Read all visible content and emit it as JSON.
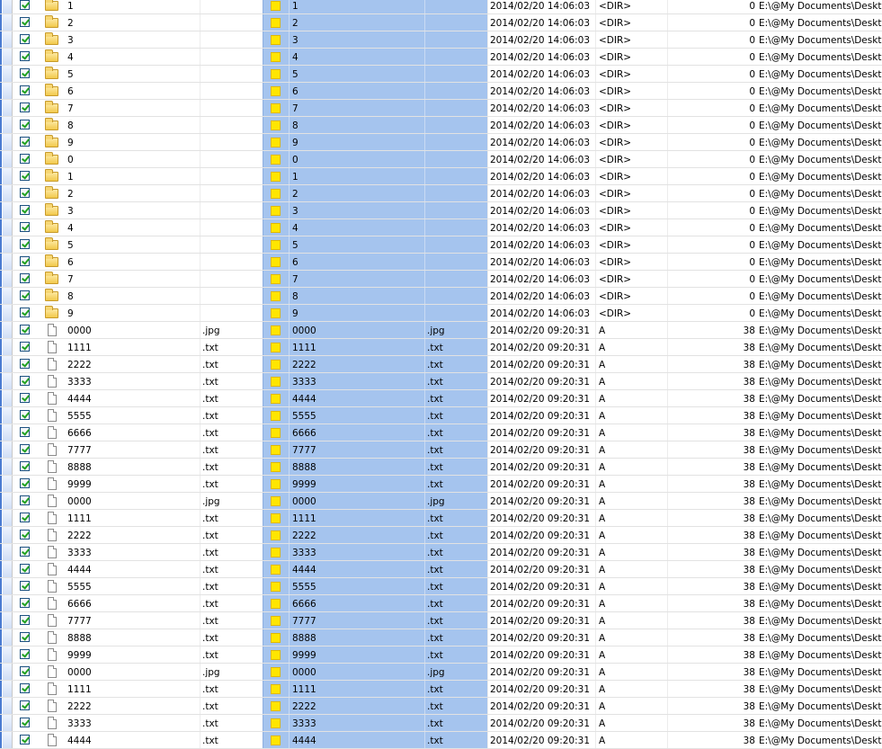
{
  "rows": [
    {
      "type": "folder",
      "checked": true,
      "name": "1",
      "ext": "",
      "sel_name": "1",
      "sel_ext": "",
      "date": "2014/02/20 14:06:03",
      "attr": "<DIR>",
      "size": "0",
      "path": "E:\\@My Documents\\Desktop"
    },
    {
      "type": "folder",
      "checked": true,
      "name": "2",
      "ext": "",
      "sel_name": "2",
      "sel_ext": "",
      "date": "2014/02/20 14:06:03",
      "attr": "<DIR>",
      "size": "0",
      "path": "E:\\@My Documents\\Desktop"
    },
    {
      "type": "folder",
      "checked": true,
      "name": "3",
      "ext": "",
      "sel_name": "3",
      "sel_ext": "",
      "date": "2014/02/20 14:06:03",
      "attr": "<DIR>",
      "size": "0",
      "path": "E:\\@My Documents\\Desktop"
    },
    {
      "type": "folder",
      "checked": true,
      "name": "4",
      "ext": "",
      "sel_name": "4",
      "sel_ext": "",
      "date": "2014/02/20 14:06:03",
      "attr": "<DIR>",
      "size": "0",
      "path": "E:\\@My Documents\\Desktop"
    },
    {
      "type": "folder",
      "checked": true,
      "name": "5",
      "ext": "",
      "sel_name": "5",
      "sel_ext": "",
      "date": "2014/02/20 14:06:03",
      "attr": "<DIR>",
      "size": "0",
      "path": "E:\\@My Documents\\Desktop"
    },
    {
      "type": "folder",
      "checked": true,
      "name": "6",
      "ext": "",
      "sel_name": "6",
      "sel_ext": "",
      "date": "2014/02/20 14:06:03",
      "attr": "<DIR>",
      "size": "0",
      "path": "E:\\@My Documents\\Desktop"
    },
    {
      "type": "folder",
      "checked": true,
      "name": "7",
      "ext": "",
      "sel_name": "7",
      "sel_ext": "",
      "date": "2014/02/20 14:06:03",
      "attr": "<DIR>",
      "size": "0",
      "path": "E:\\@My Documents\\Desktop"
    },
    {
      "type": "folder",
      "checked": true,
      "name": "8",
      "ext": "",
      "sel_name": "8",
      "sel_ext": "",
      "date": "2014/02/20 14:06:03",
      "attr": "<DIR>",
      "size": "0",
      "path": "E:\\@My Documents\\Desktop"
    },
    {
      "type": "folder",
      "checked": true,
      "name": "9",
      "ext": "",
      "sel_name": "9",
      "sel_ext": "",
      "date": "2014/02/20 14:06:03",
      "attr": "<DIR>",
      "size": "0",
      "path": "E:\\@My Documents\\Desktop"
    },
    {
      "type": "folder",
      "checked": true,
      "name": "0",
      "ext": "",
      "sel_name": "0",
      "sel_ext": "",
      "date": "2014/02/20 14:06:03",
      "attr": "<DIR>",
      "size": "0",
      "path": "E:\\@My Documents\\Desktop"
    },
    {
      "type": "folder",
      "checked": true,
      "name": "1",
      "ext": "",
      "sel_name": "1",
      "sel_ext": "",
      "date": "2014/02/20 14:06:03",
      "attr": "<DIR>",
      "size": "0",
      "path": "E:\\@My Documents\\Desktop"
    },
    {
      "type": "folder",
      "checked": true,
      "name": "2",
      "ext": "",
      "sel_name": "2",
      "sel_ext": "",
      "date": "2014/02/20 14:06:03",
      "attr": "<DIR>",
      "size": "0",
      "path": "E:\\@My Documents\\Desktop"
    },
    {
      "type": "folder",
      "checked": true,
      "name": "3",
      "ext": "",
      "sel_name": "3",
      "sel_ext": "",
      "date": "2014/02/20 14:06:03",
      "attr": "<DIR>",
      "size": "0",
      "path": "E:\\@My Documents\\Desktop"
    },
    {
      "type": "folder",
      "checked": true,
      "name": "4",
      "ext": "",
      "sel_name": "4",
      "sel_ext": "",
      "date": "2014/02/20 14:06:03",
      "attr": "<DIR>",
      "size": "0",
      "path": "E:\\@My Documents\\Desktop"
    },
    {
      "type": "folder",
      "checked": true,
      "name": "5",
      "ext": "",
      "sel_name": "5",
      "sel_ext": "",
      "date": "2014/02/20 14:06:03",
      "attr": "<DIR>",
      "size": "0",
      "path": "E:\\@My Documents\\Desktop"
    },
    {
      "type": "folder",
      "checked": true,
      "name": "6",
      "ext": "",
      "sel_name": "6",
      "sel_ext": "",
      "date": "2014/02/20 14:06:03",
      "attr": "<DIR>",
      "size": "0",
      "path": "E:\\@My Documents\\Desktop"
    },
    {
      "type": "folder",
      "checked": true,
      "name": "7",
      "ext": "",
      "sel_name": "7",
      "sel_ext": "",
      "date": "2014/02/20 14:06:03",
      "attr": "<DIR>",
      "size": "0",
      "path": "E:\\@My Documents\\Desktop"
    },
    {
      "type": "folder",
      "checked": true,
      "name": "8",
      "ext": "",
      "sel_name": "8",
      "sel_ext": "",
      "date": "2014/02/20 14:06:03",
      "attr": "<DIR>",
      "size": "0",
      "path": "E:\\@My Documents\\Desktop"
    },
    {
      "type": "folder",
      "checked": true,
      "name": "9",
      "ext": "",
      "sel_name": "9",
      "sel_ext": "",
      "date": "2014/02/20 14:06:03",
      "attr": "<DIR>",
      "size": "0",
      "path": "E:\\@My Documents\\Desktop"
    },
    {
      "type": "file",
      "checked": true,
      "name": "0000",
      "ext": ".jpg",
      "sel_name": "0000",
      "sel_ext": ".jpg",
      "date": "2014/02/20 09:20:31",
      "attr": "A",
      "size": "38",
      "path": "E:\\@My Documents\\Desktop"
    },
    {
      "type": "file",
      "checked": true,
      "name": "1111",
      "ext": ".txt",
      "sel_name": "1111",
      "sel_ext": ".txt",
      "date": "2014/02/20 09:20:31",
      "attr": "A",
      "size": "38",
      "path": "E:\\@My Documents\\Desktop"
    },
    {
      "type": "file",
      "checked": true,
      "name": "2222",
      "ext": ".txt",
      "sel_name": "2222",
      "sel_ext": ".txt",
      "date": "2014/02/20 09:20:31",
      "attr": "A",
      "size": "38",
      "path": "E:\\@My Documents\\Desktop"
    },
    {
      "type": "file",
      "checked": true,
      "name": "3333",
      "ext": ".txt",
      "sel_name": "3333",
      "sel_ext": ".txt",
      "date": "2014/02/20 09:20:31",
      "attr": "A",
      "size": "38",
      "path": "E:\\@My Documents\\Desktop"
    },
    {
      "type": "file",
      "checked": true,
      "name": "4444",
      "ext": ".txt",
      "sel_name": "4444",
      "sel_ext": ".txt",
      "date": "2014/02/20 09:20:31",
      "attr": "A",
      "size": "38",
      "path": "E:\\@My Documents\\Desktop"
    },
    {
      "type": "file",
      "checked": true,
      "name": "5555",
      "ext": ".txt",
      "sel_name": "5555",
      "sel_ext": ".txt",
      "date": "2014/02/20 09:20:31",
      "attr": "A",
      "size": "38",
      "path": "E:\\@My Documents\\Desktop"
    },
    {
      "type": "file",
      "checked": true,
      "name": "6666",
      "ext": ".txt",
      "sel_name": "6666",
      "sel_ext": ".txt",
      "date": "2014/02/20 09:20:31",
      "attr": "A",
      "size": "38",
      "path": "E:\\@My Documents\\Desktop"
    },
    {
      "type": "file",
      "checked": true,
      "name": "7777",
      "ext": ".txt",
      "sel_name": "7777",
      "sel_ext": ".txt",
      "date": "2014/02/20 09:20:31",
      "attr": "A",
      "size": "38",
      "path": "E:\\@My Documents\\Desktop"
    },
    {
      "type": "file",
      "checked": true,
      "name": "8888",
      "ext": ".txt",
      "sel_name": "8888",
      "sel_ext": ".txt",
      "date": "2014/02/20 09:20:31",
      "attr": "A",
      "size": "38",
      "path": "E:\\@My Documents\\Desktop"
    },
    {
      "type": "file",
      "checked": true,
      "name": "9999",
      "ext": ".txt",
      "sel_name": "9999",
      "sel_ext": ".txt",
      "date": "2014/02/20 09:20:31",
      "attr": "A",
      "size": "38",
      "path": "E:\\@My Documents\\Desktop"
    },
    {
      "type": "file",
      "checked": true,
      "name": "0000",
      "ext": ".jpg",
      "sel_name": "0000",
      "sel_ext": ".jpg",
      "date": "2014/02/20 09:20:31",
      "attr": "A",
      "size": "38",
      "path": "E:\\@My Documents\\Desktop"
    },
    {
      "type": "file",
      "checked": true,
      "name": "1111",
      "ext": ".txt",
      "sel_name": "1111",
      "sel_ext": ".txt",
      "date": "2014/02/20 09:20:31",
      "attr": "A",
      "size": "38",
      "path": "E:\\@My Documents\\Desktop"
    },
    {
      "type": "file",
      "checked": true,
      "name": "2222",
      "ext": ".txt",
      "sel_name": "2222",
      "sel_ext": ".txt",
      "date": "2014/02/20 09:20:31",
      "attr": "A",
      "size": "38",
      "path": "E:\\@My Documents\\Desktop"
    },
    {
      "type": "file",
      "checked": true,
      "name": "3333",
      "ext": ".txt",
      "sel_name": "3333",
      "sel_ext": ".txt",
      "date": "2014/02/20 09:20:31",
      "attr": "A",
      "size": "38",
      "path": "E:\\@My Documents\\Desktop"
    },
    {
      "type": "file",
      "checked": true,
      "name": "4444",
      "ext": ".txt",
      "sel_name": "4444",
      "sel_ext": ".txt",
      "date": "2014/02/20 09:20:31",
      "attr": "A",
      "size": "38",
      "path": "E:\\@My Documents\\Desktop"
    },
    {
      "type": "file",
      "checked": true,
      "name": "5555",
      "ext": ".txt",
      "sel_name": "5555",
      "sel_ext": ".txt",
      "date": "2014/02/20 09:20:31",
      "attr": "A",
      "size": "38",
      "path": "E:\\@My Documents\\Desktop"
    },
    {
      "type": "file",
      "checked": true,
      "name": "6666",
      "ext": ".txt",
      "sel_name": "6666",
      "sel_ext": ".txt",
      "date": "2014/02/20 09:20:31",
      "attr": "A",
      "size": "38",
      "path": "E:\\@My Documents\\Desktop"
    },
    {
      "type": "file",
      "checked": true,
      "name": "7777",
      "ext": ".txt",
      "sel_name": "7777",
      "sel_ext": ".txt",
      "date": "2014/02/20 09:20:31",
      "attr": "A",
      "size": "38",
      "path": "E:\\@My Documents\\Desktop"
    },
    {
      "type": "file",
      "checked": true,
      "name": "8888",
      "ext": ".txt",
      "sel_name": "8888",
      "sel_ext": ".txt",
      "date": "2014/02/20 09:20:31",
      "attr": "A",
      "size": "38",
      "path": "E:\\@My Documents\\Desktop"
    },
    {
      "type": "file",
      "checked": true,
      "name": "9999",
      "ext": ".txt",
      "sel_name": "9999",
      "sel_ext": ".txt",
      "date": "2014/02/20 09:20:31",
      "attr": "A",
      "size": "38",
      "path": "E:\\@My Documents\\Desktop"
    },
    {
      "type": "file",
      "checked": true,
      "name": "0000",
      "ext": ".jpg",
      "sel_name": "0000",
      "sel_ext": ".jpg",
      "date": "2014/02/20 09:20:31",
      "attr": "A",
      "size": "38",
      "path": "E:\\@My Documents\\Desktop"
    },
    {
      "type": "file",
      "checked": true,
      "name": "1111",
      "ext": ".txt",
      "sel_name": "1111",
      "sel_ext": ".txt",
      "date": "2014/02/20 09:20:31",
      "attr": "A",
      "size": "38",
      "path": "E:\\@My Documents\\Desktop"
    },
    {
      "type": "file",
      "checked": true,
      "name": "2222",
      "ext": ".txt",
      "sel_name": "2222",
      "sel_ext": ".txt",
      "date": "2014/02/20 09:20:31",
      "attr": "A",
      "size": "38",
      "path": "E:\\@My Documents\\Desktop"
    },
    {
      "type": "file",
      "checked": true,
      "name": "3333",
      "ext": ".txt",
      "sel_name": "3333",
      "sel_ext": ".txt",
      "date": "2014/02/20 09:20:31",
      "attr": "A",
      "size": "38",
      "path": "E:\\@My Documents\\Desktop"
    },
    {
      "type": "file",
      "checked": true,
      "name": "4444",
      "ext": ".txt",
      "sel_name": "4444",
      "sel_ext": ".txt",
      "date": "2014/02/20 09:20:31",
      "attr": "A",
      "size": "38",
      "path": "E:\\@My Documents\\Desktop"
    }
  ],
  "colors": {
    "selection": "#a5c4ee",
    "marker": "#4a7bd1",
    "check": "#21a121",
    "status_square": "#ffe600"
  }
}
